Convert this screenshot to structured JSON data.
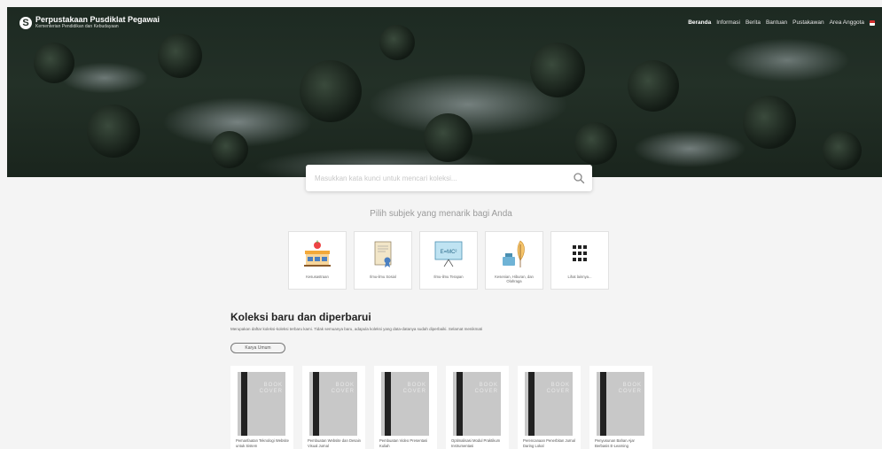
{
  "brand": {
    "logo_letter": "S",
    "title": "Perpustakaan Pusdiklat Pegawai",
    "subtitle": "Kementerian Pendidikan dan Kebudayaan"
  },
  "nav": {
    "items": [
      {
        "label": "Beranda",
        "active": true
      },
      {
        "label": "Informasi",
        "active": false
      },
      {
        "label": "Berita",
        "active": false
      },
      {
        "label": "Bantuan",
        "active": false
      },
      {
        "label": "Pustakawan",
        "active": false
      },
      {
        "label": "Area Anggota",
        "active": false
      }
    ]
  },
  "search": {
    "placeholder": "Masukkan kata kunci untuk mencari koleksi..."
  },
  "subjects": {
    "heading": "Pilih subjek yang menarik bagi Anda",
    "items": [
      {
        "label": "Kesusastraan",
        "icon": "school-building-icon"
      },
      {
        "label": "Ilmu-ilmu Sosial",
        "icon": "certificate-scroll-icon"
      },
      {
        "label": "Ilmu-ilmu Terapan",
        "icon": "projector-board-icon"
      },
      {
        "label": "Kesenian, Hiburan, dan Olahraga",
        "icon": "ink-quill-icon"
      },
      {
        "label": "Lihat lainnya...",
        "icon": "grid-dots-icon"
      }
    ]
  },
  "collection": {
    "title": "Koleksi baru dan diperbarui",
    "description": "Merupakan daftar koleksi-koleksi terbaru kami. Tidak semuanya baru, adapula koleksi yang data-datanya sudah diperbaiki. Selamat menikmati",
    "filter_label": "Karya Umum",
    "cover_text_line1": "BOOK",
    "cover_text_line2": "COVER",
    "books": [
      {
        "title": "Pemanfaatan Teknologi Website untuk Sistem"
      },
      {
        "title": "Pembuatan Website dan Desain Visual Jurnal"
      },
      {
        "title": "Pembuatan Video Presentasi Kuliah"
      },
      {
        "title": "Optimalisasi Modul Praktikum Instrumentasi"
      },
      {
        "title": "Perencanaan Penerbitan Jurnal Daring Lokal"
      },
      {
        "title": "Penyusunan Bahan Ajar Berbasis E-Learning"
      }
    ]
  },
  "colors": {
    "accent_flag": "#d32f2f",
    "page_bg": "#f4f4f4"
  }
}
